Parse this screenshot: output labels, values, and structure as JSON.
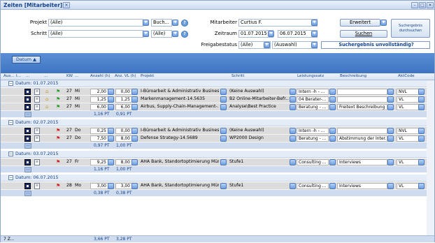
{
  "window": {
    "title": "Zeiten [Mitarbeiter]"
  },
  "filters": {
    "projekt_label": "Projekt",
    "projekt_value": "(Alle)",
    "buch_value": "Buch...",
    "schritt_label": "Schritt",
    "schritt_value": "(Alle)",
    "schritt2_value": "(Alle)",
    "mitarbeiter_label": "Mitarbeiter",
    "mitarbeiter_value": "Curtius F.",
    "zeitraum_label": "Zeitraum",
    "zeitraum_from": "01.07.2015",
    "zeitraum_to": "06.07.2015",
    "freigabe_label": "Freigabestatus",
    "freigabe_value": "(Alle)",
    "freigabe2_value": "(Auswahl)",
    "erweitert_label": "Erweitert",
    "suchen_label": "Suchen",
    "durchsuchen_label": "Suchergebnis durchsuchen",
    "status_text": "Suchergebnis unvollständig?"
  },
  "grid": {
    "group_chip": "Datum ▲",
    "columns": [
      "Aus...",
      "I...",
      "...",
      "...",
      "KW",
      "...",
      "Anzahl (h)",
      "Anz. VL (h)",
      "Projekt",
      "Schritt",
      "Leistungssatz",
      "Beschreibung",
      "AktCode"
    ],
    "groups": [
      {
        "label": "Datum: 01.07.2015",
        "rows": [
          {
            "kw": "27",
            "day": "Mi",
            "anzahl": "2,00",
            "vl": "0,00",
            "projekt": "I-Büroarbeit & Administrativ Busines...",
            "schritt": "(Keine Auswahl)",
            "leistung": "Intern -h - ...",
            "beschreibung": "",
            "akt": "NVL",
            "flag": "green"
          },
          {
            "kw": "27",
            "day": "Mi",
            "anzahl": "1,25",
            "vl": "1,25",
            "projekt": "Markenmanagement-14.5635",
            "schritt": "B2 Online-Mitarbeiter-Befr...",
            "leistung": "04 Berater-...",
            "beschreibung": "",
            "akt": "VL",
            "flag": "green"
          },
          {
            "kw": "27",
            "day": "Mi",
            "anzahl": "6,00",
            "vl": "6,00",
            "projekt": "Airbus, Supply-Chain-Management-...",
            "schritt": "Analyse\\Best Practice",
            "leistung": "Beratung - ...",
            "beschreibung": "Freitext Beschreibung",
            "akt": "VL",
            "flag": "green"
          }
        ],
        "sum_anzahl": "1,16 PT",
        "sum_vl": "0,91 PT"
      },
      {
        "label": "Datum: 02.07.2015",
        "rows": [
          {
            "kw": "27",
            "day": "Do",
            "anzahl": "0,25",
            "vl": "0,00",
            "projekt": "I-Büroarbeit & Administrativ Busines...",
            "schritt": "(Keine Auswahl)",
            "leistung": "Intern -h - ...",
            "beschreibung": "",
            "akt": "NVL",
            "flag": "red"
          },
          {
            "kw": "27",
            "day": "Do",
            "anzahl": "7,50",
            "vl": "8,00",
            "projekt": "Defense Strategy-14.5689",
            "schritt": "WP2000 Design",
            "leistung": "Beratung - ...",
            "beschreibung": "Abstimmung der Inter...",
            "akt": "VL",
            "flag": "red"
          }
        ],
        "sum_anzahl": "0,97 PT",
        "sum_vl": "1,00 PT"
      },
      {
        "label": "Datum: 03.07.2015",
        "rows": [
          {
            "kw": "27",
            "day": "Fr",
            "anzahl": "9,25",
            "vl": "8,00",
            "projekt": "AHA Bank, Standortoptimierung Mün...",
            "schritt": "Stufe1",
            "leistung": "Consulting ...",
            "beschreibung": "Interviews",
            "akt": "VL",
            "flag": "red"
          }
        ],
        "sum_anzahl": "1,16 PT",
        "sum_vl": "1,00 PT"
      },
      {
        "label": "Datum: 06.07.2015",
        "rows": [
          {
            "kw": "28",
            "day": "Mo",
            "anzahl": "3,00",
            "vl": "3,00",
            "projekt": "AHA Bank, Standortoptimierung Mün...",
            "schritt": "Stufe1",
            "leistung": "Consulting ...",
            "beschreibung": "Interviews",
            "akt": "VL",
            "flag": "red"
          }
        ],
        "sum_anzahl": "0,38 PT",
        "sum_vl": "0,38 PT"
      }
    ],
    "footer_count": "7 Z...",
    "footer_anzahl": "3,66 PT",
    "footer_vl": "3,28 PT"
  },
  "colors": {
    "accent": "#3e74c2",
    "flag_green": "#2e9b2e",
    "flag_red": "#d22020"
  }
}
